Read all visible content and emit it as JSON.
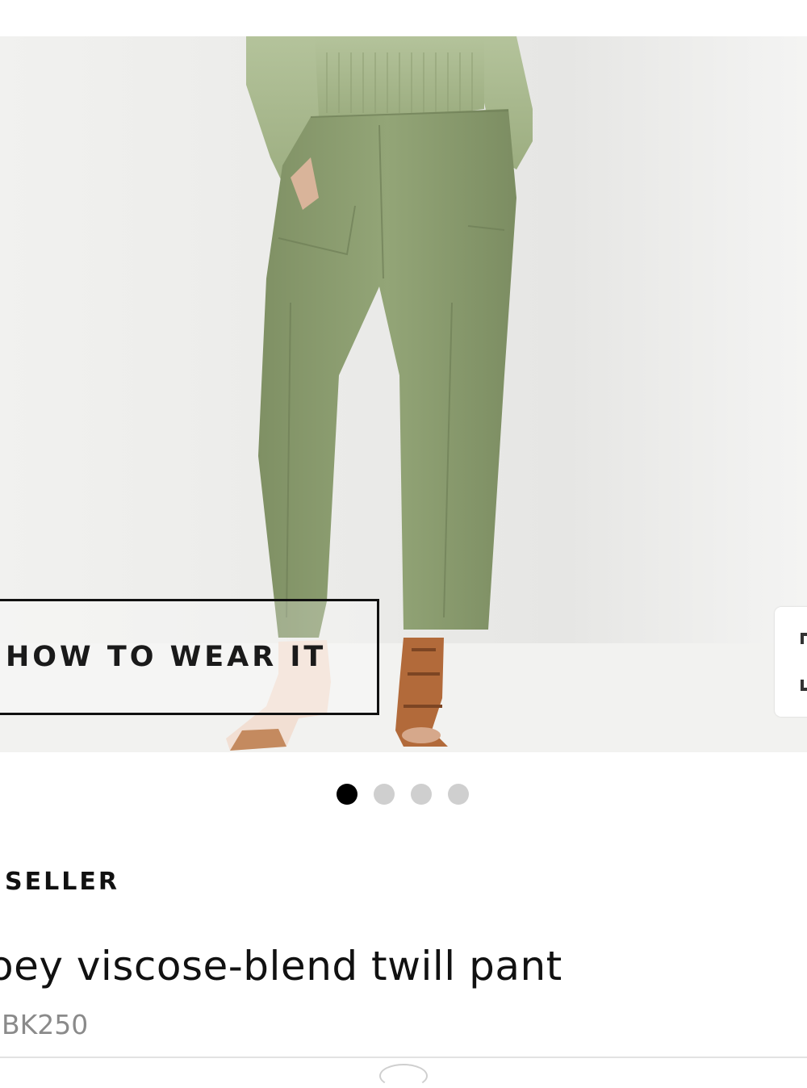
{
  "product_image": {
    "alt": "Model wearing sage green twill pant with green knit sweater and brown sandals",
    "colors": {
      "pant": "#8d9e70",
      "sweater": "#a9b98e",
      "background": "#ececea"
    }
  },
  "how_to_wear": {
    "label": "HOW TO WEAR IT"
  },
  "carousel": {
    "count": 4,
    "active_index": 0
  },
  "product": {
    "badge": "SELLER",
    "title": "oey viscose-blend twill pant",
    "sku": "BK250"
  },
  "icons": {
    "expand": "expand-icon"
  }
}
